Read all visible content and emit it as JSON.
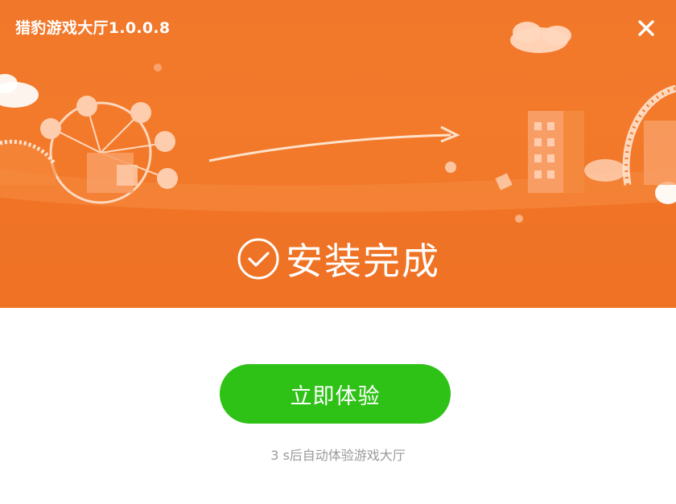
{
  "window": {
    "title": "猎豹游戏大厅1.0.0.8",
    "close_icon": "close-icon"
  },
  "status": {
    "icon": "check-circle-icon",
    "text": "安装完成"
  },
  "actions": {
    "primary_label": "立即体验"
  },
  "countdown": {
    "text": "3 s后自动体验游戏大厅"
  },
  "colors": {
    "header_orange": "#f1772a",
    "button_green": "#2ec216",
    "hint_gray": "#9a9a9a"
  }
}
